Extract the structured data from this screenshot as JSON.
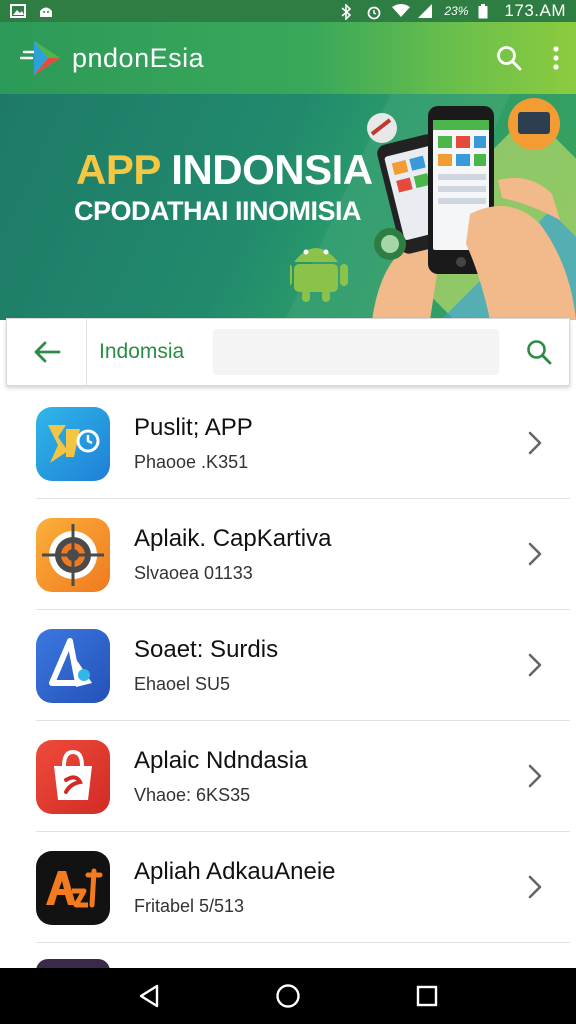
{
  "status_bar": {
    "battery_percent": "23%",
    "time": "173.AM"
  },
  "app_bar": {
    "title": "pndonEsia",
    "icons": [
      "play-store-logo",
      "search-icon",
      "more-vert-icon"
    ]
  },
  "banner": {
    "headline_highlight": "APP",
    "headline_rest": " INDONSIA",
    "subheadline": "CPODATHAI IINOMISIA"
  },
  "search": {
    "query": "Indomsia",
    "field_value": ""
  },
  "apps": [
    {
      "name": "Puslit; APP",
      "subtitle": "Phaooe .K351"
    },
    {
      "name": "Aplaik. CapKartiva",
      "subtitle": "Slvaoea 01133"
    },
    {
      "name": "Soaet: Surdis",
      "subtitle": "Ehaoel SU5"
    },
    {
      "name": "Aplaic Ndndasia",
      "subtitle": "Vhaoe: 6KS35"
    },
    {
      "name": "Apliah AdkauAneie",
      "subtitle": "Fritabel 5/513"
    }
  ],
  "colors": {
    "app_bar_start": "#2c9a58",
    "app_bar_end": "#8ccb3f",
    "accent_green": "#2a8c45"
  }
}
